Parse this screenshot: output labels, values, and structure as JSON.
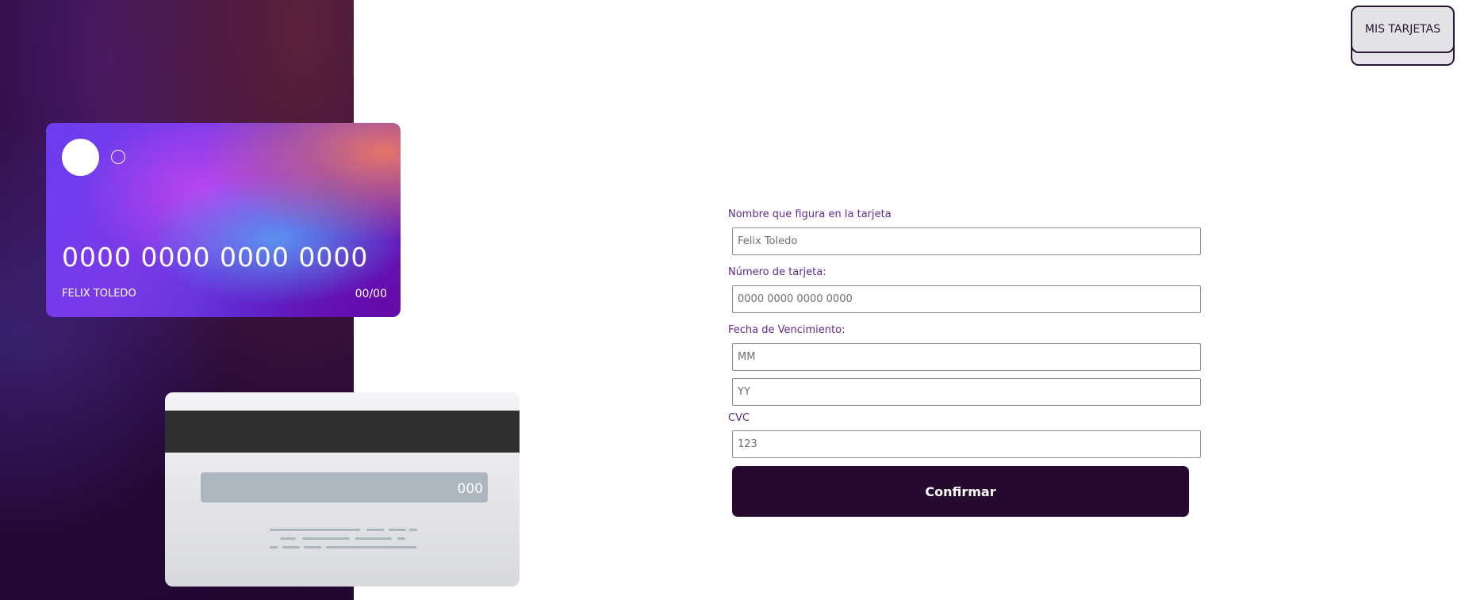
{
  "header": {
    "my_cards_label": "MIS TARJETAS"
  },
  "card_front": {
    "number": "0000 0000 0000 0000",
    "holder": "FELIX TOLEDO",
    "expiry": "00/00"
  },
  "card_back": {
    "cvc": "000"
  },
  "form": {
    "name_label": "Nombre que figura en la tarjeta",
    "name_placeholder": "Felix Toledo",
    "number_label": "Número de tarjeta:",
    "number_placeholder": "0000 0000 0000 0000",
    "expiry_label": "Fecha de Vencimiento:",
    "month_placeholder": "MM",
    "year_placeholder": "YY",
    "cvc_label": "CVC",
    "cvc_placeholder": "123",
    "confirm_label": "Confirmar"
  },
  "colors": {
    "brand_dark": "#25092f",
    "label_purple": "#5e2a8c"
  }
}
